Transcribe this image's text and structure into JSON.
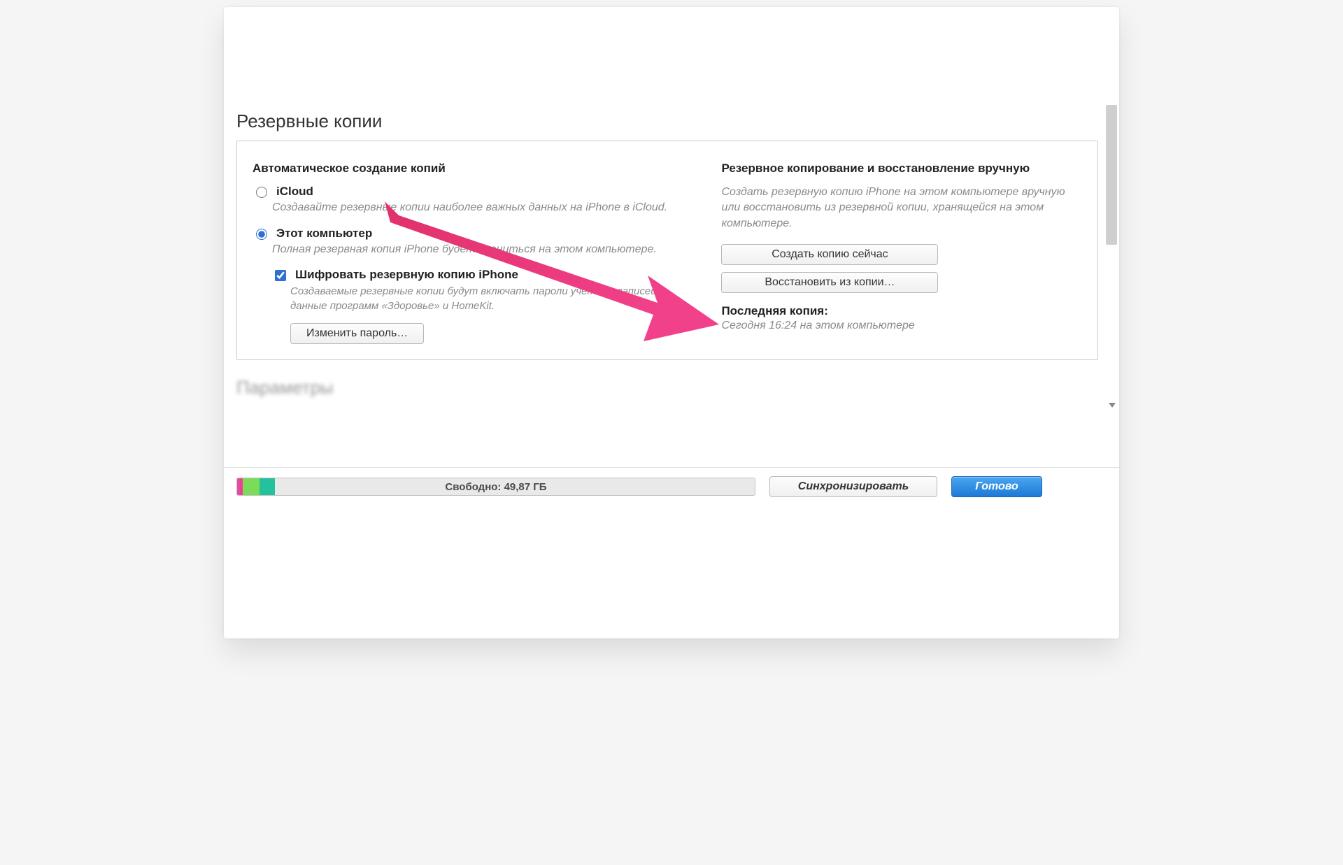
{
  "section_title": "Резервные копии",
  "left": {
    "heading": "Автоматическое создание копий",
    "icloud_label": "iCloud",
    "icloud_desc": "Создавайте резервные копии наиболее важных данных на iPhone в iCloud.",
    "computer_label": "Этот компьютер",
    "computer_desc": "Полная резервная копия iPhone будет храниться на этом компьютере.",
    "encrypt_label": "Шифровать резервную копию iPhone",
    "encrypt_desc": "Создаваемые резервные копии будут включать пароли учетных записей и данные программ «Здоровье» и HomeKit.",
    "change_password_btn": "Изменить пароль…"
  },
  "right": {
    "heading": "Резервное копирование и восстановление вручную",
    "desc": "Создать резервную копию iPhone на этом компьютере вручную или восстановить из резервной копии, хранящейся на этом компьютере.",
    "backup_now_btn": "Создать копию сейчас",
    "restore_btn": "Восстановить из копии…",
    "last_backup_head": "Последняя копия:",
    "last_backup_text": "Сегодня 16:24 на этом компьютере"
  },
  "params_title": "Параметры",
  "storage": {
    "label": "Свободно: 49,87 ГБ",
    "segments": [
      {
        "color": "#e24aa6",
        "pct": 0.6
      },
      {
        "color": "#ef3f95",
        "pct": 0.5
      },
      {
        "color": "#7cdc5a",
        "pct": 3.2
      },
      {
        "color": "#23c29c",
        "pct": 3.0
      }
    ]
  },
  "sync_btn": "Синхронизировать",
  "done_btn": "Готово"
}
